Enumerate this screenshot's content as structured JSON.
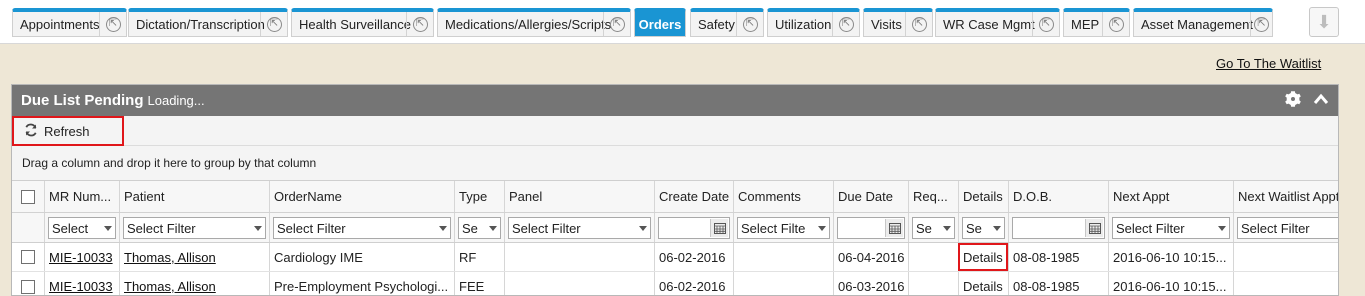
{
  "tabs": [
    {
      "label": "Appointments",
      "active": false
    },
    {
      "label": "Dictation/Transcription",
      "active": false
    },
    {
      "label": "Health Surveillance",
      "active": false
    },
    {
      "label": "Medications/Allergies/Scripts",
      "active": false
    },
    {
      "label": "Orders",
      "active": true
    },
    {
      "label": "Safety",
      "active": false
    },
    {
      "label": "Utilization",
      "active": false
    },
    {
      "label": "Visits",
      "active": false
    },
    {
      "label": "WR Case Mgmt",
      "active": false
    },
    {
      "label": "MEP",
      "active": false
    },
    {
      "label": "Asset Management",
      "active": false
    }
  ],
  "waitlist_link": "Go To The Waitlist",
  "panel": {
    "title": "Due List Pending",
    "status": "Loading...",
    "refresh_label": "Refresh",
    "grouping_hint": "Drag a column and drop it here to group by that column"
  },
  "columns": [
    "MR Num...",
    "Patient",
    "OrderName",
    "Type",
    "Panel",
    "Create Date",
    "Comments",
    "Due Date",
    "Req...",
    "Details",
    "D.O.B.",
    "Next Appt",
    "Next Waitlist Appt"
  ],
  "filters": {
    "mr": "Select",
    "patient": "Select Filter",
    "ordername": "Select Filter",
    "type": "Se",
    "panel": "Select Filter",
    "comments": "Select Filte",
    "req": "Se",
    "details": "Se",
    "nextappt": "Select Filter",
    "nextwait": "Select Filter"
  },
  "rows": [
    {
      "mr": "MIE-10033",
      "patient": "Thomas, Allison",
      "ordername": "Cardiology IME",
      "type": "RF",
      "panel": "",
      "create_date": "06-02-2016",
      "comments": "",
      "due_date": "06-04-2016",
      "req": "",
      "details": "Details",
      "dob": "08-08-1985",
      "next_appt": "2016-06-10 10:15...",
      "next_wait": ""
    },
    {
      "mr": "MIE-10033",
      "patient": "Thomas, Allison",
      "ordername": "Pre-Employment Psychologi...",
      "type": "FEE",
      "panel": "",
      "create_date": "06-02-2016",
      "comments": "",
      "due_date": "06-03-2016",
      "req": "",
      "details": "Details",
      "dob": "08-08-1985",
      "next_appt": "2016-06-10 10:15...",
      "next_wait": ""
    }
  ]
}
